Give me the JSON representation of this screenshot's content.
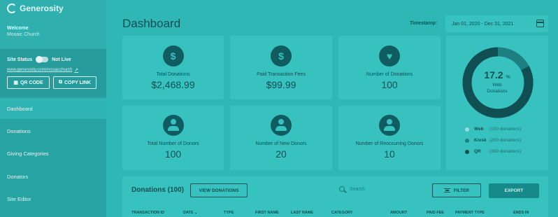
{
  "app": {
    "name": "Generosity"
  },
  "sidebar": {
    "welcome": "Welcome",
    "church": "Mosaic Church",
    "site_status_label": "Site Status",
    "site_status_value": "Not Live",
    "site_url": "www.generosity.com/mosaicchurch",
    "qr_button": "QR CODE",
    "copy_button": "COPY LINK",
    "items": [
      {
        "label": "Dashboard",
        "active": true
      },
      {
        "label": "Donations"
      },
      {
        "label": "Giving Categories"
      },
      {
        "label": "Donators"
      },
      {
        "label": "Site Editor"
      }
    ]
  },
  "header": {
    "title": "Dashboard",
    "timestamp_label": "Timestamp:",
    "timestamp_value": "Jan 01, 2020 - Dec 31, 2021"
  },
  "stats": [
    {
      "label": "Total Donations",
      "value": "$2,468.99",
      "icon": "dollar-icon"
    },
    {
      "label": "Paid Transaction Fees",
      "value": "$99.99",
      "icon": "dollar-icon"
    },
    {
      "label": "Number of Donations",
      "value": "100",
      "icon": "heart-hand-icon"
    },
    {
      "label": "Total Number of Donors",
      "value": "100",
      "icon": "person-icon"
    },
    {
      "label": "Number of New Donors",
      "value": "20",
      "icon": "person-icon"
    },
    {
      "label": "Number of Reoccurring Donors",
      "value": "10",
      "icon": "person-icon"
    }
  ],
  "donut": {
    "percent": "17.2",
    "percent_sign": "%",
    "label_line1": "Web",
    "label_line2": "Donations",
    "legend": [
      {
        "name": "Web",
        "count": "(100 donations)",
        "color": "#9bdcda"
      },
      {
        "name": "Kiosk",
        "count": "(200 donations)",
        "color": "#1d7f81"
      },
      {
        "name": "QR",
        "count": "(300 donations)",
        "color": "#0f4f52"
      }
    ]
  },
  "donations_table": {
    "title": "Donations (100)",
    "view_button": "VIEW DONATIONS",
    "search_placeholder": "Search",
    "filter_button": "FILTER",
    "export_button": "EXPORT",
    "columns": [
      "TRANSACTION ID",
      "DATE",
      "TYPE",
      "FIRST NAME",
      "LAST NAME",
      "CATEGORY",
      "AMOUNT",
      "PAID FEE",
      "PAYMENT TYPE",
      "ENDS IN"
    ]
  },
  "colors": {
    "sidebar": "#27a3a3",
    "content": "#2fb7b5",
    "card": "#37c2c0",
    "accent_dark": "#0f5d60"
  }
}
